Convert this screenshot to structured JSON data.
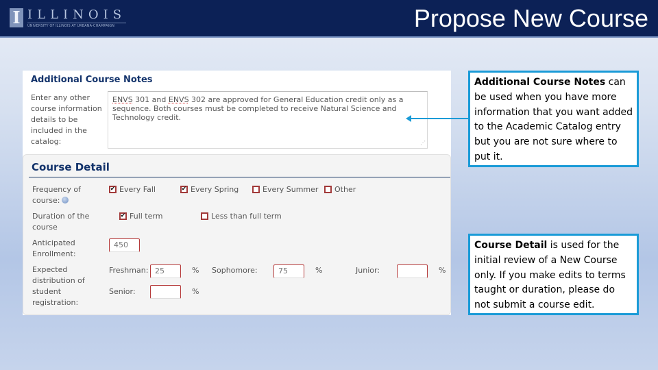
{
  "header": {
    "logo_mark": "I",
    "logo_word": "ILLINOIS",
    "logo_sub": "UNIVERSITY OF ILLINOIS AT URBANA-CHAMPAIGN",
    "title": "Propose New Course",
    "background_color": "#0c2156"
  },
  "notes": {
    "heading": "Additional Course Notes",
    "label": "Enter any other course information details to be included in the catalog:",
    "text_parts": {
      "w1": "ENVS",
      "t1": " 301 and ",
      "w2": "ENVS",
      "t2": " 302 are approved for General Education credit only as a sequence. Both courses must be completed to receive Natural Science and Technology credit."
    },
    "resize_grip": "⋰"
  },
  "course_detail": {
    "heading": "Course Detail",
    "frequency": {
      "label": "Frequency of course:",
      "options": [
        {
          "label": "Every Fall",
          "checked": true,
          "mark": "✔"
        },
        {
          "label": "Every Spring",
          "checked": true,
          "mark": "✔"
        },
        {
          "label": "Every Summer",
          "checked": false,
          "mark": ""
        },
        {
          "label": "Other",
          "checked": false,
          "mark": ""
        }
      ]
    },
    "duration": {
      "label": "Duration of the course",
      "options": [
        {
          "label": "Full term",
          "checked": true,
          "mark": "✔"
        },
        {
          "label": "Less than full term",
          "checked": false,
          "mark": ""
        }
      ]
    },
    "enrollment": {
      "label": "Anticipated Enrollment:",
      "value": "450"
    },
    "distribution": {
      "label": "Expected distribution of student registration:",
      "percent_sign": "%",
      "fields": [
        {
          "label": "Freshman:",
          "value": "25"
        },
        {
          "label": "Sophomore:",
          "value": "75"
        },
        {
          "label": "Junior:",
          "value": ""
        },
        {
          "label": "Senior:",
          "value": ""
        }
      ]
    }
  },
  "callouts": [
    {
      "bold": "Additional Course Notes",
      "text": " can be used when you have more information that you want added to the Academic Catalog entry but you are not sure where to put it."
    },
    {
      "bold": "Course Detail",
      "text": " is used for the initial review of a New Course only. If you make edits to terms taught or duration, please do not submit a course edit."
    }
  ],
  "colors": {
    "accent": "#1a9bd7",
    "heading": "#13336b",
    "required_border": "#b53a3a"
  }
}
